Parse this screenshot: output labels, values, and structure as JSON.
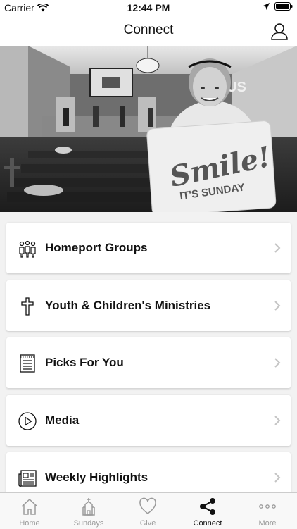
{
  "status_bar": {
    "carrier": "Carrier",
    "time": "12:44 PM"
  },
  "nav": {
    "title": "Connect"
  },
  "hero": {
    "sign_line1": "Smile!",
    "sign_line2": "IT'S SUNDAY",
    "screen_text": "US"
  },
  "menu": {
    "items": [
      {
        "label": "Homeport Groups",
        "icon": "people-group-icon"
      },
      {
        "label": "Youth & Children's Ministries",
        "icon": "cross-icon"
      },
      {
        "label": "Picks For You",
        "icon": "notepad-icon"
      },
      {
        "label": "Media",
        "icon": "play-circle-icon"
      },
      {
        "label": "Weekly Highlights",
        "icon": "newspaper-icon"
      }
    ]
  },
  "tabs": [
    {
      "label": "Home",
      "icon": "home-icon",
      "active": false
    },
    {
      "label": "Sundays",
      "icon": "chapel-icon",
      "active": false
    },
    {
      "label": "Give",
      "icon": "heart-icon",
      "active": false
    },
    {
      "label": "Connect",
      "icon": "share-icon",
      "active": true
    },
    {
      "label": "More",
      "icon": "more-dots-icon",
      "active": false
    }
  ],
  "colors": {
    "active_tab": "#111111",
    "inactive_tab": "#9a9a9a",
    "background": "#f2f2f2"
  }
}
